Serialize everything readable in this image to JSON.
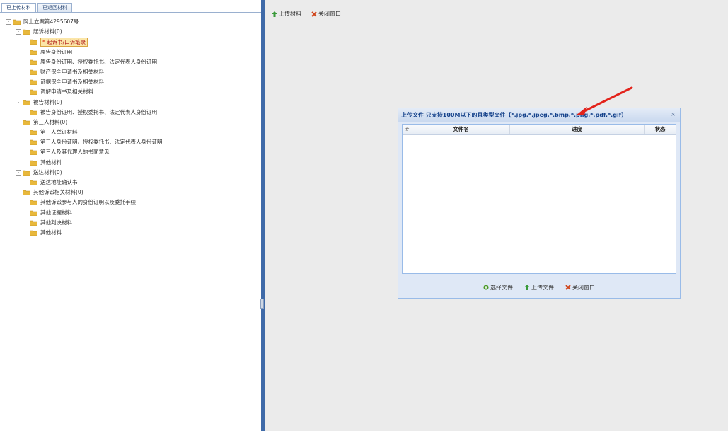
{
  "left_panel": {
    "tabs": [
      {
        "label": "已上传材料",
        "active": true
      },
      {
        "label": "已退回材料",
        "active": false
      }
    ],
    "tree": [
      {
        "label": "网上立案第4295607号",
        "level": 0,
        "toggle": "-"
      },
      {
        "label": "起诉材料(0)",
        "level": 1,
        "toggle": "-"
      },
      {
        "label": "起诉书/口诉笔录",
        "level": 2,
        "selected": true,
        "star": true
      },
      {
        "label": "原告身份证明",
        "level": 2
      },
      {
        "label": "原告身份证明、授权委托书、法定代表人身份证明",
        "level": 2
      },
      {
        "label": "财产保全申请书及相关材料",
        "level": 2
      },
      {
        "label": "证据保全申请书及相关材料",
        "level": 2
      },
      {
        "label": "调解申请书及相关材料",
        "level": 2
      },
      {
        "label": "被告材料(0)",
        "level": 1,
        "toggle": "-"
      },
      {
        "label": "被告身份证明、授权委托书、法定代表人身份证明",
        "level": 2
      },
      {
        "label": "第三人材料(0)",
        "level": 1,
        "toggle": "-"
      },
      {
        "label": "第三人举证材料",
        "level": 2
      },
      {
        "label": "第三人身份证明、授权委托书、法定代表人身份证明",
        "level": 2
      },
      {
        "label": "第三人及其代理人的书面意见",
        "level": 2
      },
      {
        "label": "其他材料",
        "level": 2
      },
      {
        "label": "送达材料(0)",
        "level": 1,
        "toggle": "-"
      },
      {
        "label": "送达地址确认书",
        "level": 2
      },
      {
        "label": "其他诉讼相关材料(0)",
        "level": 1,
        "toggle": "-"
      },
      {
        "label": "其他诉讼参与人的身份证明以及委托手续",
        "level": 2
      },
      {
        "label": "其他证据材料",
        "level": 2
      },
      {
        "label": "其他判决材料",
        "level": 2
      },
      {
        "label": "其他材料",
        "level": 2
      }
    ]
  },
  "toolbar": {
    "upload_label": "上传材料",
    "close_label": "关闭窗口"
  },
  "dialog": {
    "title": "上传文件 只支持100M以下的且类型文件【*.jpg,*.jpeg,*.bmp,*.png,*.pdf,*.gif】",
    "close_icon": "×",
    "columns": {
      "num": "#",
      "name": "文件名",
      "progress": "进度",
      "status": "状态"
    },
    "footer": {
      "select_label": "选择文件",
      "upload_label": "上传文件",
      "close_label": "关闭窗口"
    }
  },
  "colors": {
    "splitter": "#3f6aa8",
    "dialog_title": "#15428b",
    "annotation_arrow": "#e3231b",
    "folder": "#e8b83c"
  }
}
